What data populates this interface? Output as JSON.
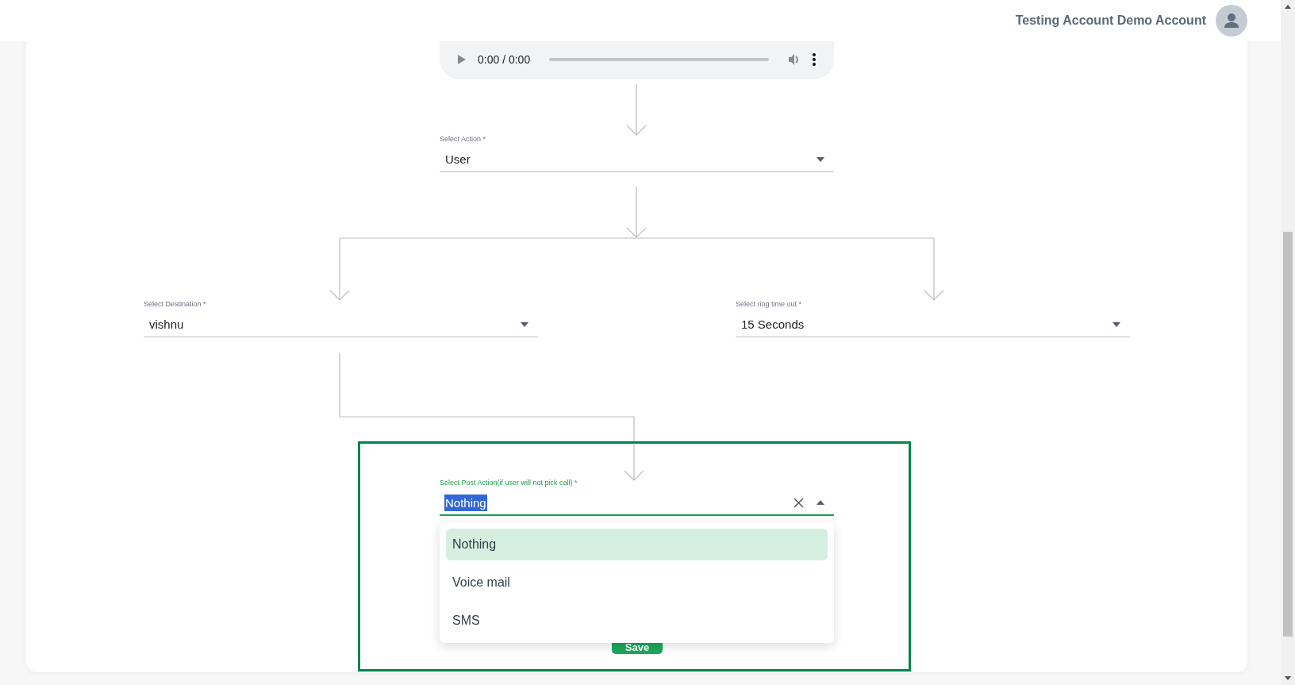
{
  "header": {
    "user_name": "Testing Account Demo Account"
  },
  "audio": {
    "time": "0:00 / 0:00"
  },
  "action": {
    "label": "Select Action *",
    "value": "User"
  },
  "destination": {
    "label": "Select Destination *",
    "value": "vishnu"
  },
  "ring_timeout": {
    "label": "Select ring time out *",
    "value": "15 Seconds"
  },
  "post_action": {
    "label": "Select Post Action(if user will not pick call) *",
    "value": "Nothing",
    "expanded": true,
    "options": [
      {
        "label": "Nothing",
        "selected": true
      },
      {
        "label": "Voice mail",
        "selected": false
      },
      {
        "label": "SMS",
        "selected": false
      }
    ]
  },
  "save_button": {
    "label": "Save"
  }
}
